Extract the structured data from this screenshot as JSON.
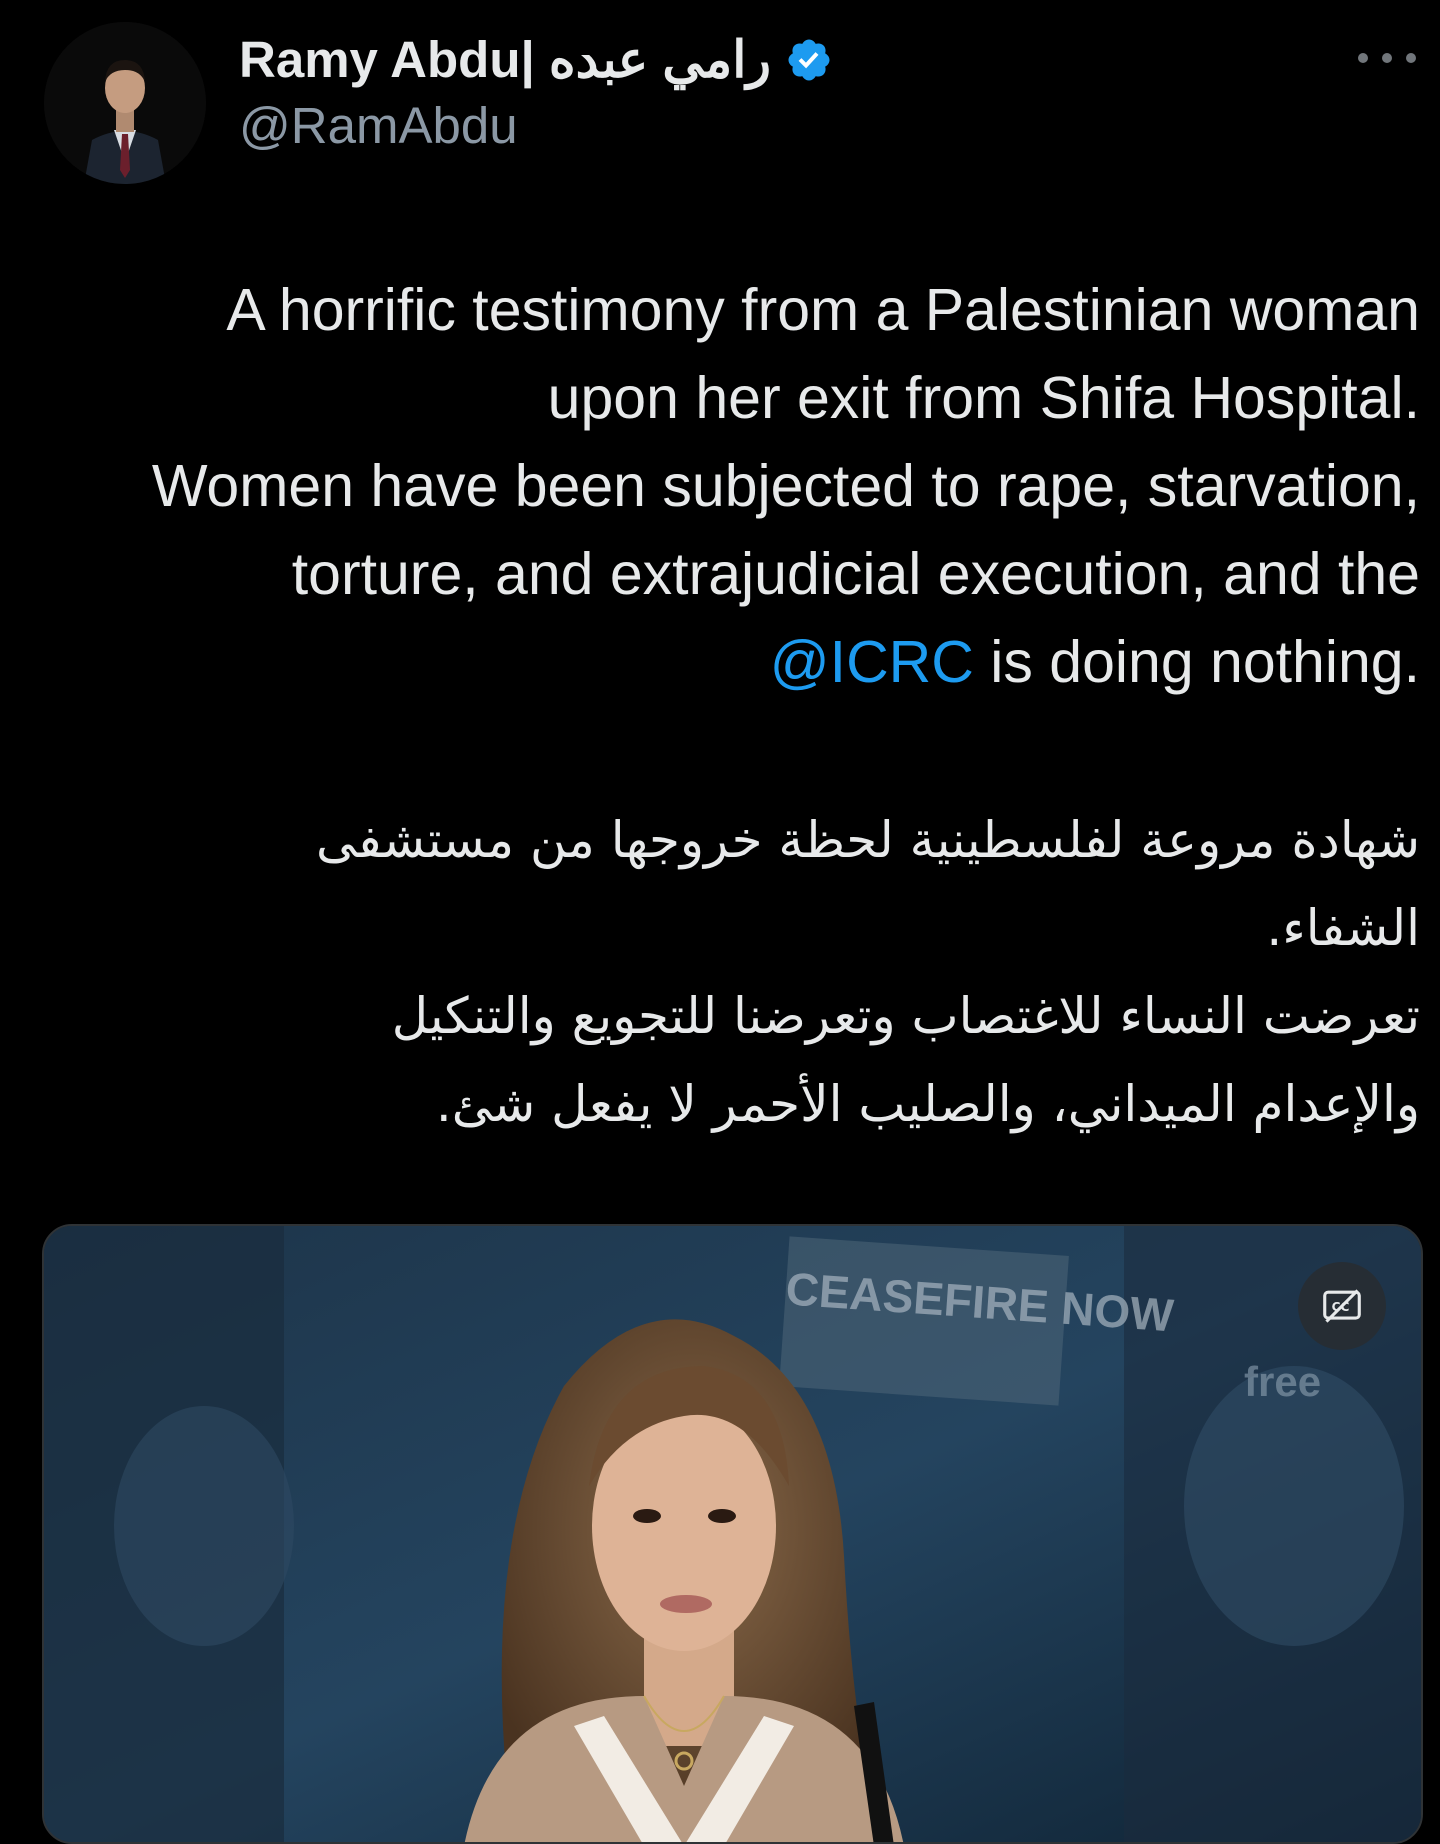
{
  "author": {
    "display_name": "Ramy Abdu| رامي عبده",
    "handle": "@RamAbdu",
    "verified": true
  },
  "tweet": {
    "en_line1": "A horrific testimony from a Palestinian woman",
    "en_line2": "upon her exit from Shifa Hospital.",
    "en_line3": "Women have been subjected to rape, starvation,",
    "en_line4": "torture, and extrajudicial execution, and the",
    "mention": "@ICRC",
    "en_line5_rest": " is doing nothing.",
    "ar_line1": "شهادة مروعة لفلسطينية لحظة خروجها من مستشفى",
    "ar_line2": "الشفاء.",
    "ar_line3": "تعرضت النساء للاغتصاب وتعرضنا للتجويع والتنكيل",
    "ar_line4": "والإعدام الميداني، والصليب الأحمر لا يفعل شئ."
  },
  "media": {
    "type": "video",
    "background_sign_text": "CEASEFIRE NOW",
    "background_sign_text2": "free",
    "captions_icon": "captions-off-icon"
  },
  "colors": {
    "background": "#000000",
    "text": "#e7e9ea",
    "secondary": "#8b98a5",
    "link": "#1d9bf0",
    "verified": "#1d9bf0"
  }
}
